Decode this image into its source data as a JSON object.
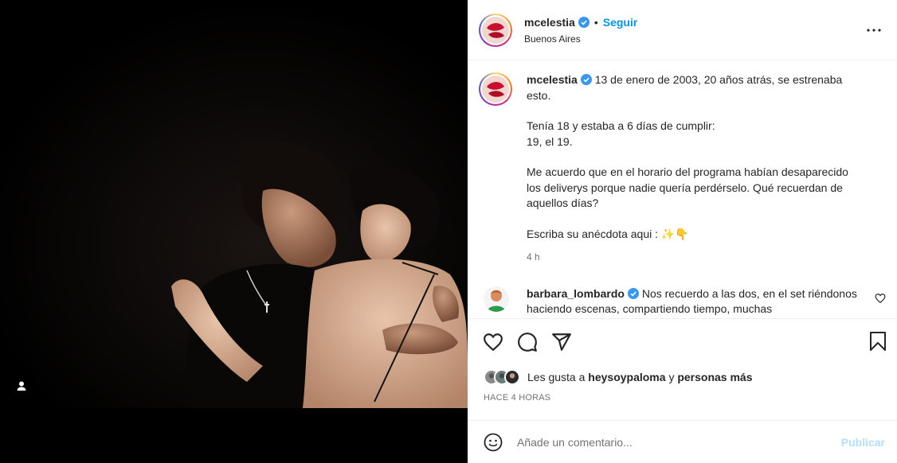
{
  "post": {
    "username": "mcelestia",
    "follow_label": "Seguir",
    "dot": "•",
    "location": "Buenos Aires",
    "more_icon": "more-horizontal-icon"
  },
  "caption": {
    "username": "mcelestia",
    "lines": [
      "13 de enero de 2003, 20 años atrás, se estrenaba esto.",
      "Tenía 18 y estaba a 6 días de cumplir:\n19, el 19.",
      "Me acuerdo que en el horario del programa habían desaparecido los deliverys porque nadie quería perdérselo. Qué recuerdan de aquellos días?",
      "Escriba su anécdota aqui : ✨👇"
    ],
    "time": "4 h"
  },
  "comment": {
    "username": "barbara_lombardo",
    "text": "Nos recuerdo a las dos, en el set riéndonos haciendo escenas, compartiendo tiempo, muchas"
  },
  "likes": {
    "prefix": "Les gusta a",
    "user": "heysoypaloma",
    "connector": "y",
    "others": "personas más"
  },
  "timestamp": "HACE 4 HORAS",
  "add_comment": {
    "placeholder": "Añade un comentario...",
    "publish_label": "Publicar"
  },
  "colors": {
    "accent": "#0095f6",
    "verified": "#3897f0",
    "publish_disabled": "#b2dffc"
  }
}
